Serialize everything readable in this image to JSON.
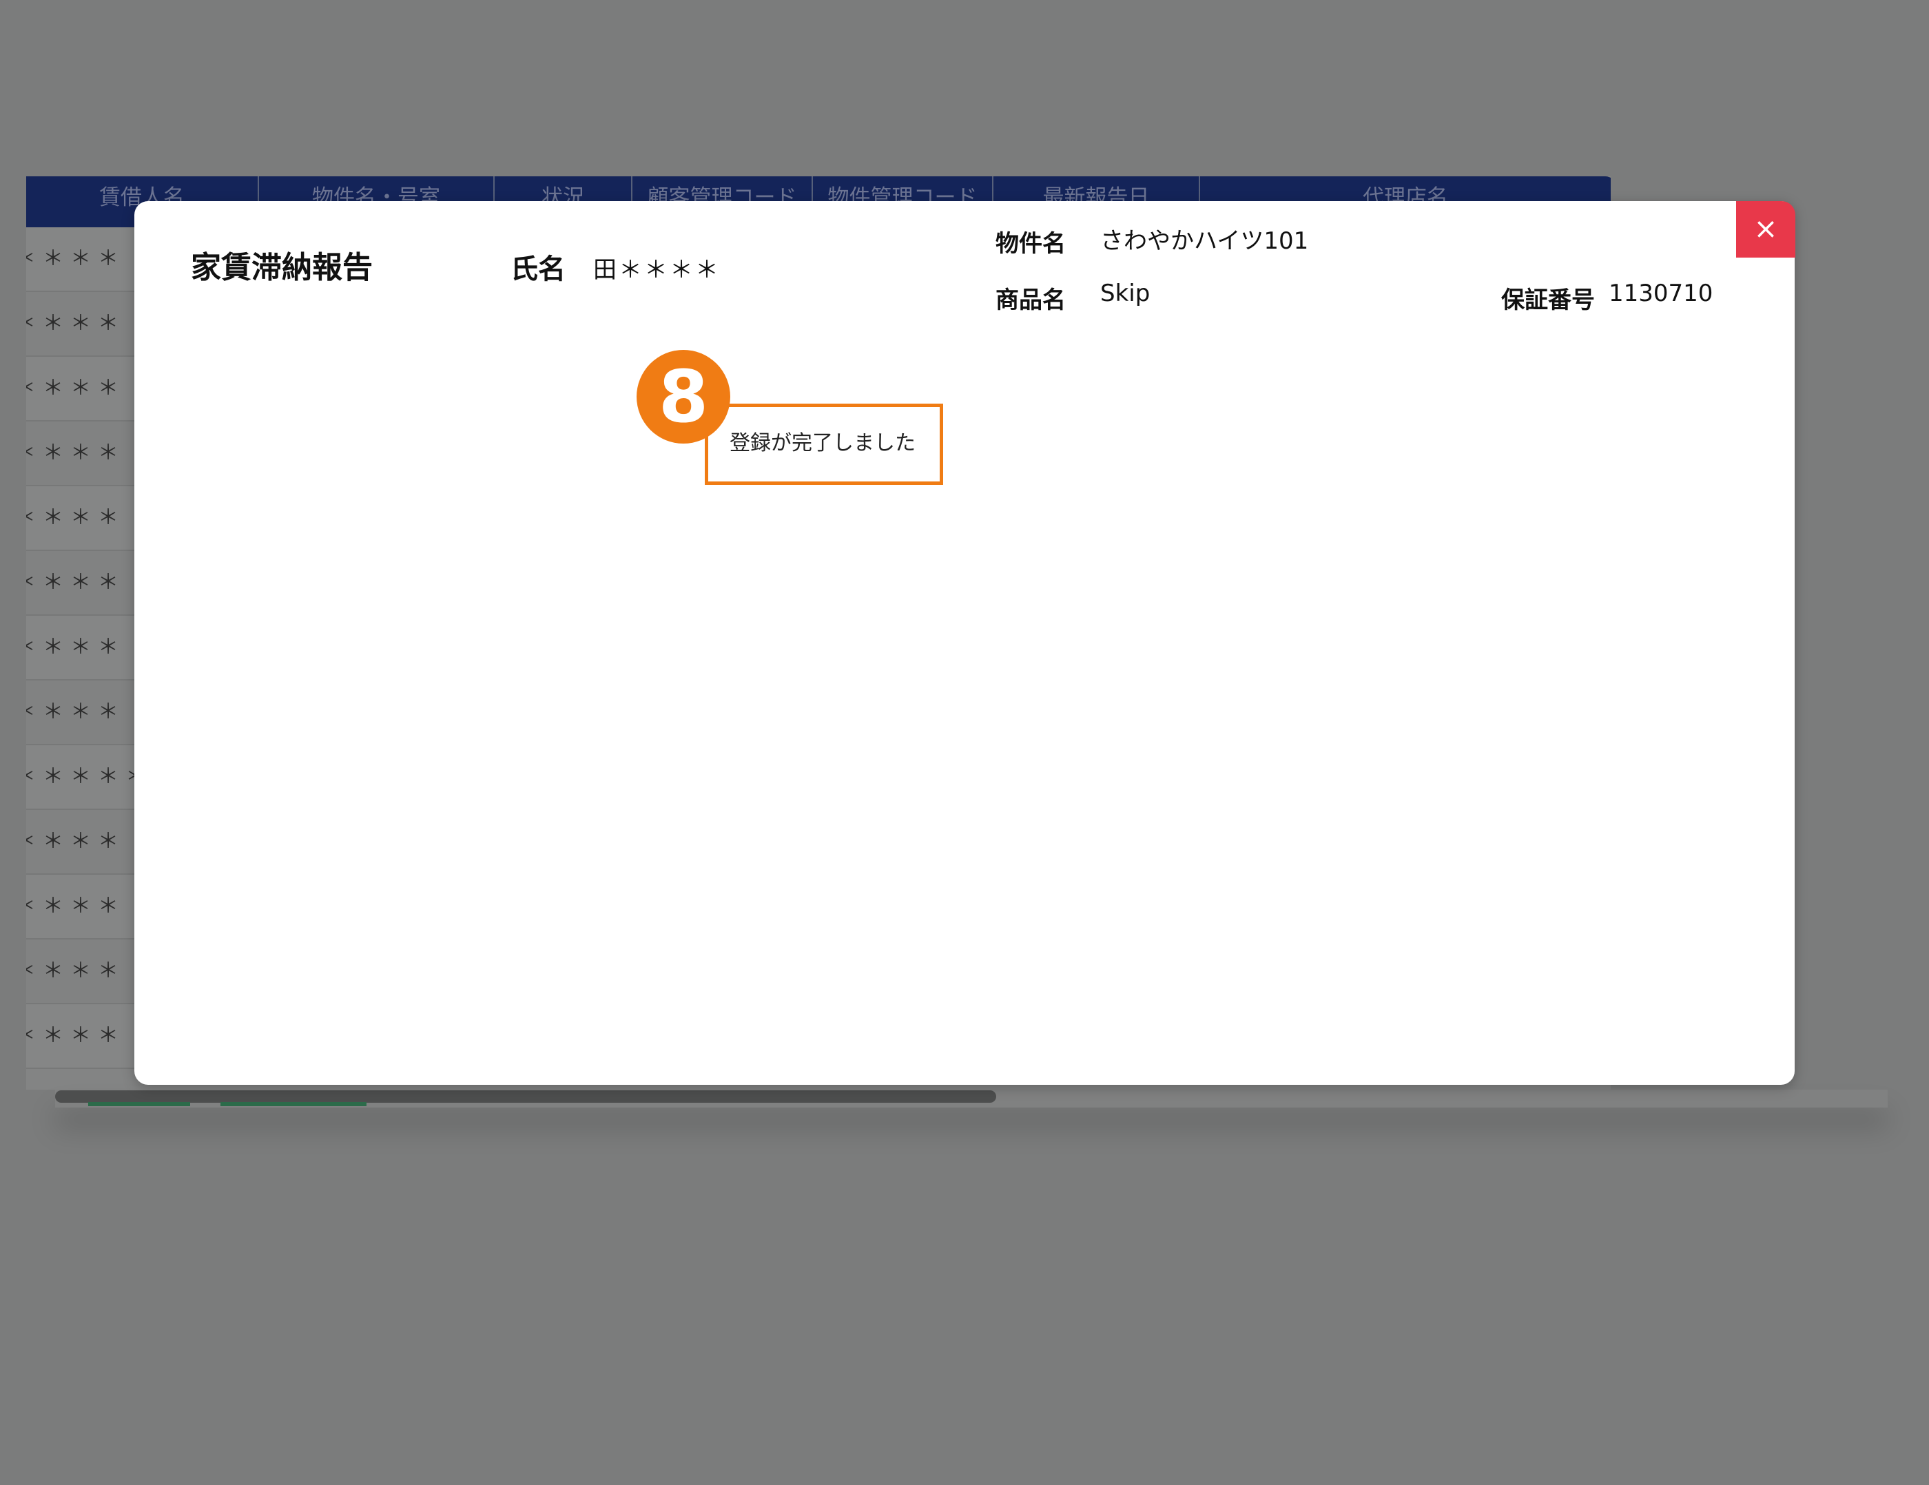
{
  "table": {
    "headers": [
      "賃借人名",
      "物件名・号室",
      "状況",
      "顧客管理コード",
      "物件管理コード",
      "最新報告日",
      "代理店名"
    ],
    "rows": [
      "＊＊＊＊",
      "＊＊＊＊",
      "＊＊＊＊",
      "＊＊＊＊",
      "＊＊＊＊",
      "＊＊＊＊",
      "＊＊＊＊",
      "＊＊＊＊",
      "＊＊＊＊＊",
      "＊＊＊＊",
      "＊＊＊＊",
      "＊＊＊＊",
      "＊＊＊＊"
    ]
  },
  "modal": {
    "title": "家賃滞納報告",
    "name_label": "氏名",
    "name_value": "田＊＊＊＊",
    "property_label": "物件名",
    "property_value": "さわやかハイツ101",
    "product_label": "商品名",
    "product_value": "Skip",
    "guarantee_label": "保証番号",
    "guarantee_value": "1130710",
    "close_label": "×",
    "message": "登録が完了しました",
    "step_number": "8"
  },
  "colors": {
    "overlay": "#7b7c7c",
    "table_header": "#142459",
    "close_button": "#e8384a",
    "highlight": "#f07c14"
  }
}
